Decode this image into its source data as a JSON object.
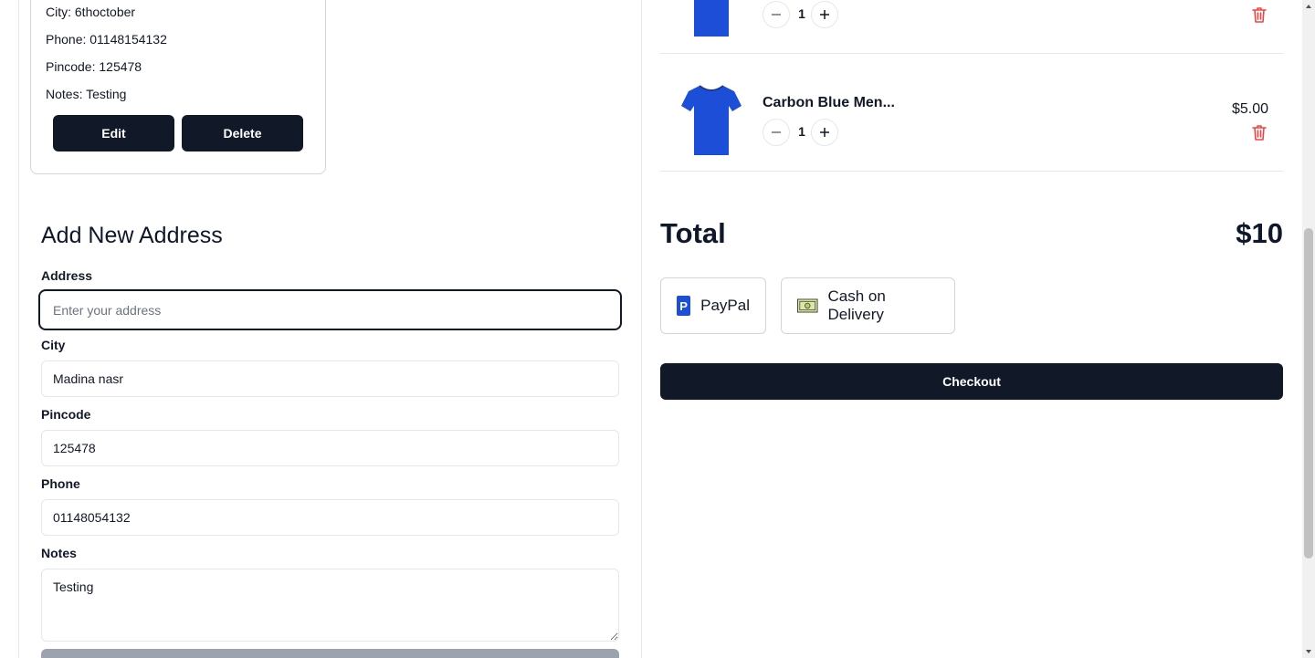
{
  "saved_address": {
    "city": "City: 6thoctober",
    "phone": "Phone: 01148154132",
    "pincode": "Pincode: 125478",
    "notes": "Notes: Testing",
    "edit_label": "Edit",
    "delete_label": "Delete"
  },
  "address_form": {
    "title": "Add New Address",
    "address_label": "Address",
    "address_placeholder": "Enter your address",
    "city_label": "City",
    "city_value": "Madina nasr",
    "pincode_label": "Pincode",
    "pincode_value": "125478",
    "phone_label": "Phone",
    "phone_value": "01148054132",
    "notes_label": "Notes",
    "notes_value": "Testing"
  },
  "cart": {
    "items": [
      {
        "name": "",
        "quantity": "1",
        "price": "",
        "image": "blue-tshirt"
      },
      {
        "name": "Carbon Blue Men...",
        "quantity": "1",
        "price": "$5.00",
        "image": "blue-tshirt"
      }
    ],
    "total_label": "Total",
    "total_value": "$10"
  },
  "payment": {
    "options": [
      {
        "label": "PayPal",
        "icon": "paypal-icon"
      },
      {
        "label": "Cash on Delivery",
        "icon": "cash-icon"
      }
    ]
  },
  "checkout_label": "Checkout",
  "colors": {
    "primary": "#111827",
    "danger": "#ef4444",
    "shirt": "#1d4ed8",
    "border": "#e5e7eb"
  }
}
